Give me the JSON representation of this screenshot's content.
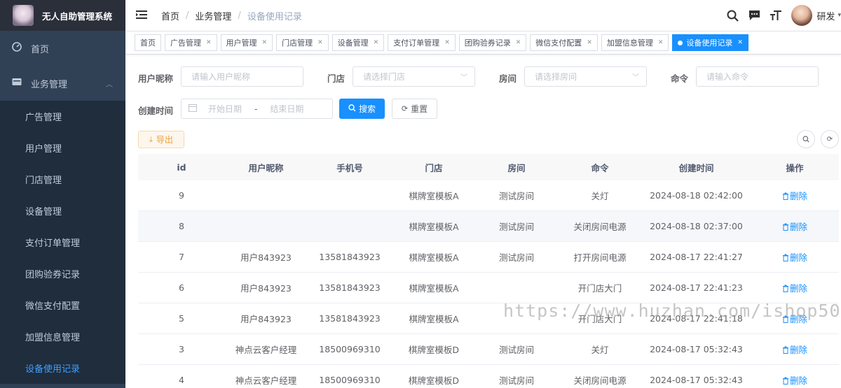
{
  "app": {
    "title": "无人自助管理系统"
  },
  "sidebar": {
    "home": "首页",
    "business": "业务管理",
    "items": [
      "广告管理",
      "用户管理",
      "门店管理",
      "设备管理",
      "支付订单管理",
      "团购验券记录",
      "微信支付配置",
      "加盟信息管理",
      "设备使用记录"
    ]
  },
  "header": {
    "breadcrumb": [
      "首页",
      "业务管理",
      "设备使用记录"
    ],
    "user_name": "研发"
  },
  "tabs": [
    "首页",
    "广告管理",
    "用户管理",
    "门店管理",
    "设备管理",
    "支付订单管理",
    "团购验券记录",
    "微信支付配置",
    "加盟信息管理",
    "设备使用记录"
  ],
  "form": {
    "nickname_label": "用户昵称",
    "nickname_placeholder": "请输入用户昵称",
    "store_label": "门店",
    "store_placeholder": "请选择门店",
    "room_label": "房间",
    "room_placeholder": "请选择房间",
    "command_label": "命令",
    "command_placeholder": "请输入命令",
    "created_label": "创建时间",
    "start_placeholder": "开始日期",
    "range_sep": "-",
    "end_placeholder": "结束日期",
    "search_button": "搜索",
    "reset_button": "重置",
    "export_button": "导出"
  },
  "table": {
    "columns": [
      "id",
      "用户昵称",
      "手机号",
      "门店",
      "房间",
      "命令",
      "创建时间",
      "操作"
    ],
    "delete_label": "删除",
    "rows": [
      [
        "9",
        "",
        "",
        "棋牌室模板A",
        "测试房间",
        "关灯",
        "2024-08-18 02:42:00"
      ],
      [
        "8",
        "",
        "",
        "棋牌室模板A",
        "测试房间",
        "关闭房间电源",
        "2024-08-18 02:37:00"
      ],
      [
        "7",
        "用户843923",
        "13581843923",
        "棋牌室模板A",
        "测试房间",
        "打开房间电源",
        "2024-08-17 22:41:27"
      ],
      [
        "6",
        "用户843923",
        "13581843923",
        "棋牌室模板A",
        "",
        "开门店大门",
        "2024-08-17 22:41:23"
      ],
      [
        "5",
        "用户843923",
        "13581843923",
        "棋牌室模板A",
        "",
        "开门店大门",
        "2024-08-17 22:41:18"
      ],
      [
        "3",
        "神点云客户经理",
        "18500969310",
        "棋牌室模板D",
        "测试房间",
        "关灯",
        "2024-08-17 05:32:43"
      ],
      [
        "4",
        "神点云客户经理",
        "18500969310",
        "棋牌室模板D",
        "测试房间",
        "关闭房间电源",
        "2024-08-17 05:32:43"
      ]
    ]
  },
  "watermark": "https://www.huzhan.com/ishop50558",
  "colors": {
    "sidebar_bg": "#304156",
    "accent": "#1890ff",
    "active_menu": "#409eff"
  }
}
